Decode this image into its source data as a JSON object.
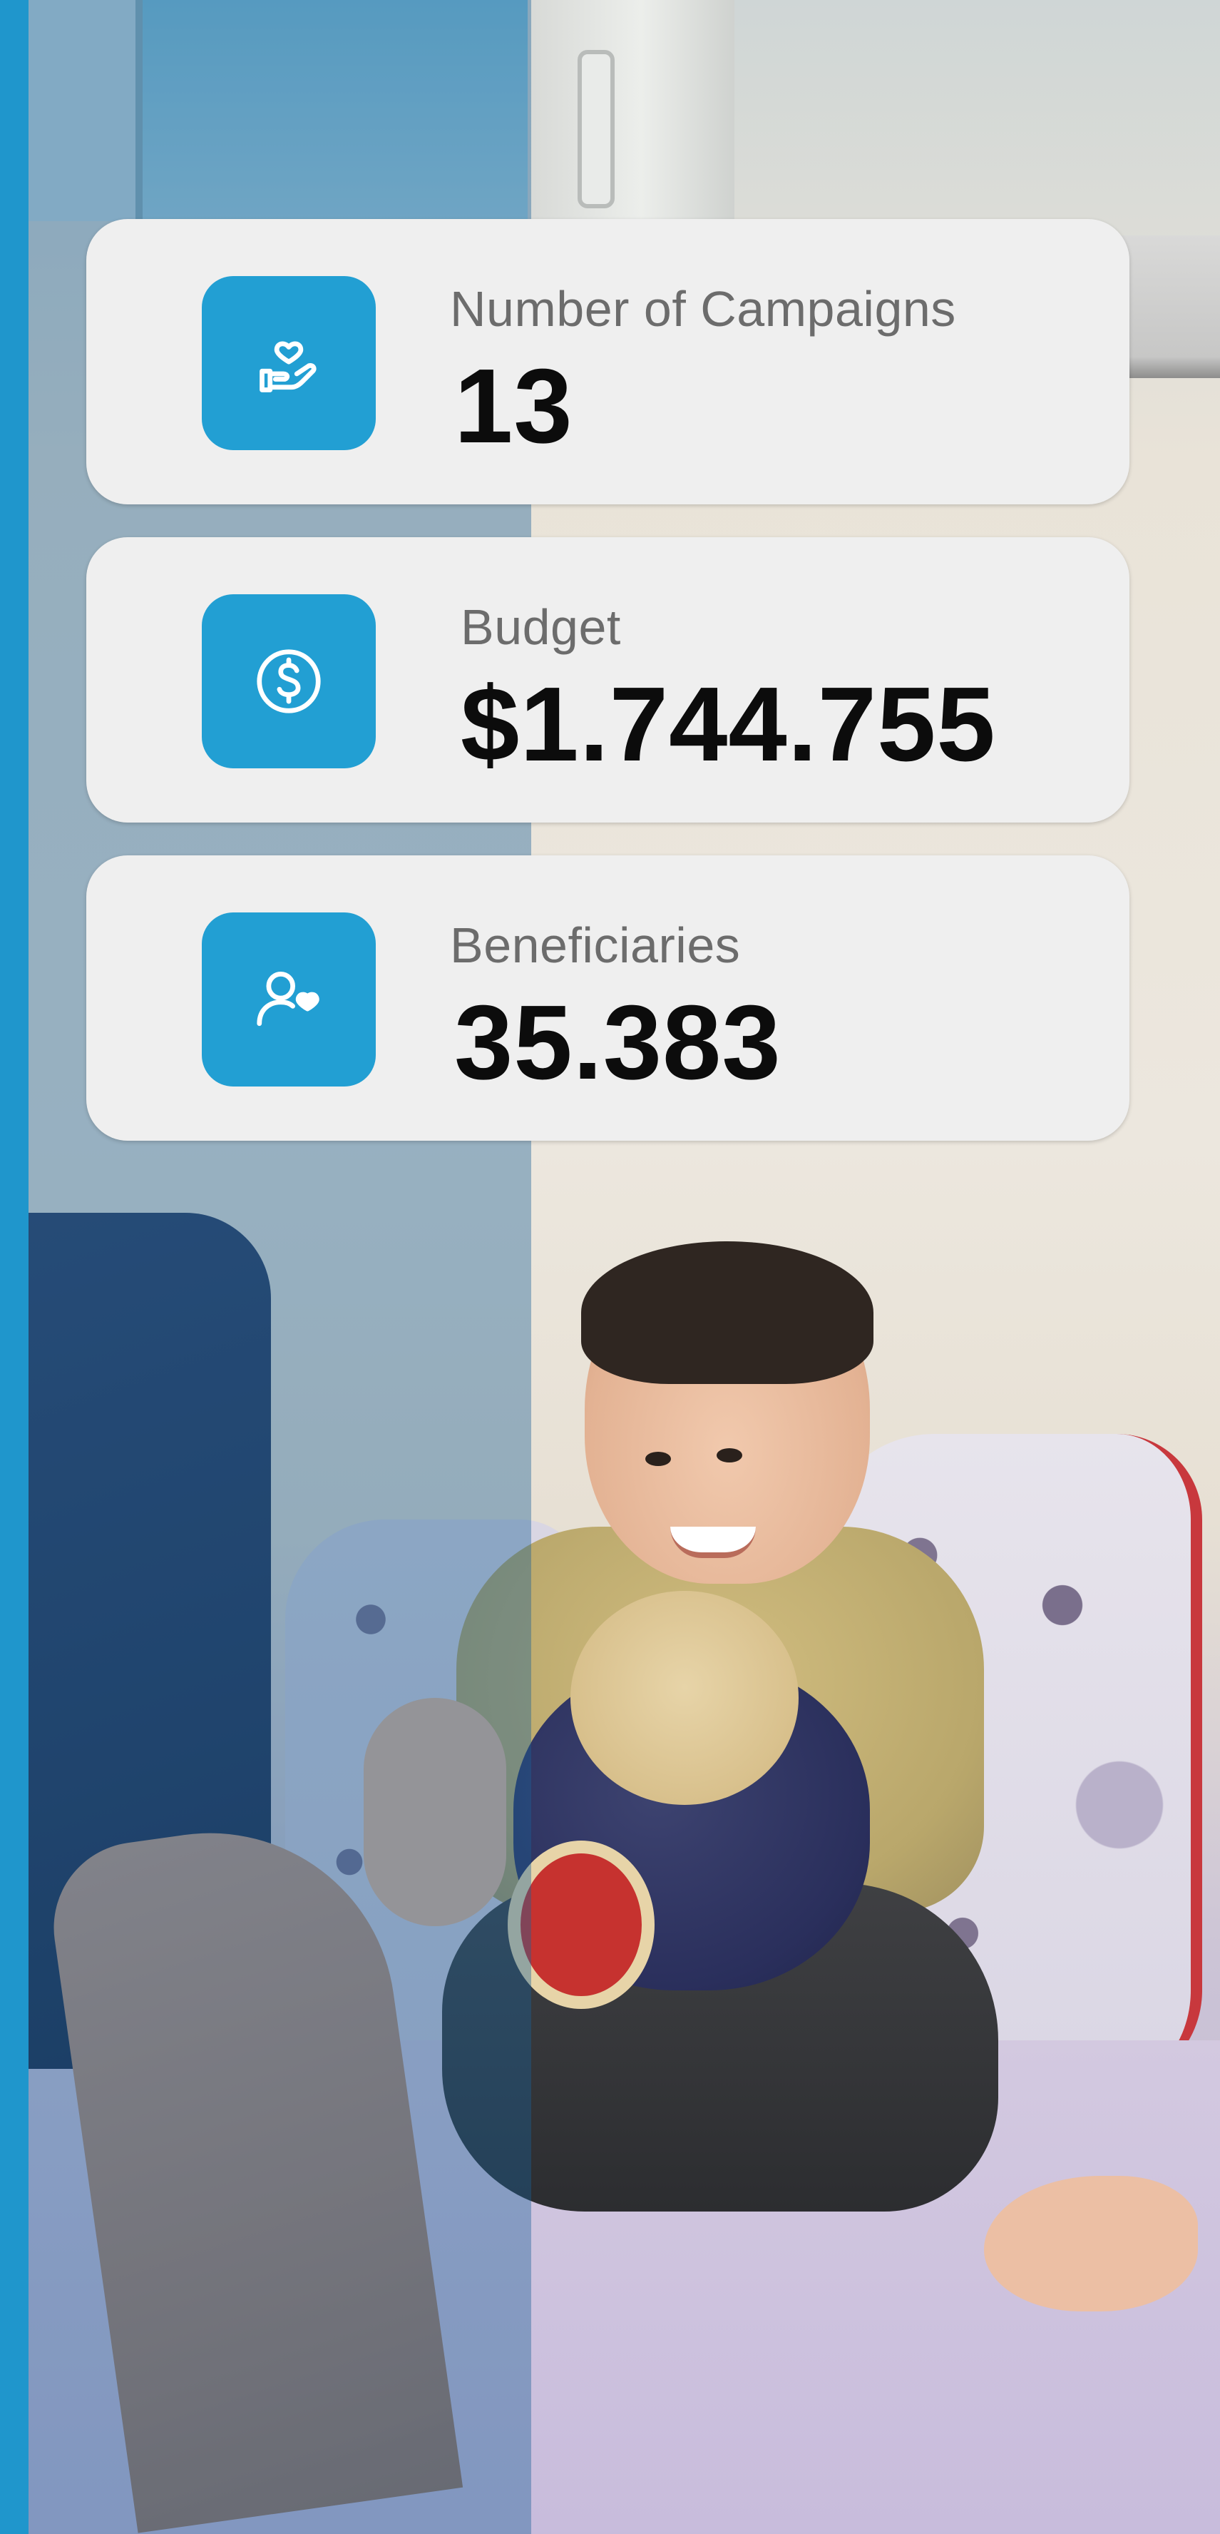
{
  "stats": {
    "campaigns": {
      "label": "Number of Campaigns",
      "value": "13",
      "icon": "hand-heart-icon"
    },
    "budget": {
      "label": "Budget",
      "value": "$1.744.755",
      "icon": "dollar-coin-icon"
    },
    "beneficiaries": {
      "label": "Beneficiaries",
      "value": "35.383",
      "icon": "person-heart-icon"
    }
  },
  "colors": {
    "accent": "#229fd3",
    "card_background": "#efefef",
    "label_text": "#6c6c6c",
    "value_text": "#0c0c0c",
    "left_stripe": "#1f96cc"
  }
}
